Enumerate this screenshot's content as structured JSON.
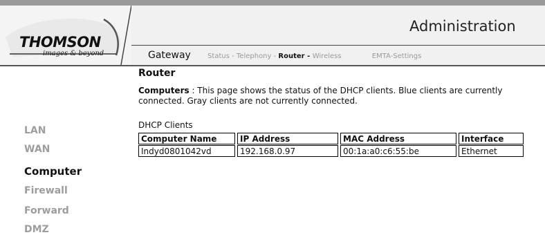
{
  "brand": {
    "name": "THOMSON",
    "tagline": "images & beyond"
  },
  "header": {
    "title": "Administration"
  },
  "nav": {
    "gateway": "Gateway",
    "items": [
      {
        "label": "Status",
        "sep": " - "
      },
      {
        "label": "Telephony",
        "sep": " - "
      },
      {
        "label": "Router",
        "sep": " - ",
        "active": true
      },
      {
        "label": "Wireless",
        "sep": ""
      },
      {
        "label": "EMTA-Settings",
        "sep": ""
      }
    ]
  },
  "sidebar": {
    "items": [
      {
        "label": "LAN"
      },
      {
        "label": "WAN"
      },
      {
        "label": "Computer",
        "active": true
      },
      {
        "label": "Firewall"
      },
      {
        "label": "Forward"
      },
      {
        "label": "DMZ"
      }
    ]
  },
  "main": {
    "page_title": "Router",
    "desc_lead": "Computers",
    "desc_text": " : This page shows the status of the DHCP clients. Blue clients are currently connected. Gray clients are not currently connected.",
    "table_caption": "DHCP Clients",
    "columns": [
      "Computer Name",
      "IP Address",
      "MAC Address",
      "Interface"
    ],
    "rows": [
      [
        "Indyd0801042vd",
        "192.168.0.97",
        "00:1a:a0:c6:55:be",
        "Ethernet"
      ]
    ]
  },
  "colors": {
    "active_text": "#111111",
    "inactive_text": "#9d9d9d",
    "header_bg": "#f1f1f1",
    "top_bar": "#9a9a9a"
  }
}
